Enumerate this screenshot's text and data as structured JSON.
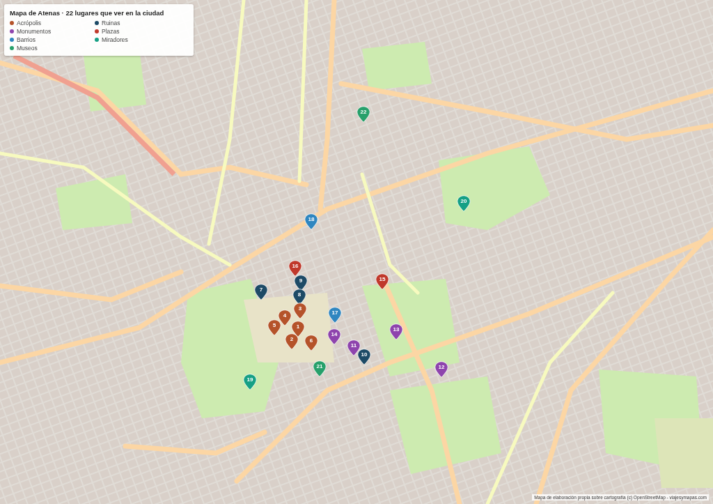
{
  "legend": {
    "title": "Mapa de Atenas · 22 lugares que ver en la ciudad",
    "items": [
      {
        "label": "Acrópolis",
        "color": "#b5532a"
      },
      {
        "label": "Monumentos",
        "color": "#8e44ad"
      },
      {
        "label": "Barrios",
        "color": "#2f86c0"
      },
      {
        "label": "Museos",
        "color": "#27a06b"
      },
      {
        "label": "Ruinas",
        "color": "#1d4a66"
      },
      {
        "label": "Plazas",
        "color": "#c0392b"
      },
      {
        "label": "Miradores",
        "color": "#16a085"
      }
    ]
  },
  "pins": [
    {
      "label": "1",
      "color": "#b5532a"
    },
    {
      "label": "2",
      "color": "#b5532a"
    },
    {
      "label": "3",
      "color": "#b5532a"
    },
    {
      "label": "4",
      "color": "#b5532a"
    },
    {
      "label": "5",
      "color": "#b5532a"
    },
    {
      "label": "6",
      "color": "#b5532a"
    },
    {
      "label": "7",
      "color": "#1d4a66"
    },
    {
      "label": "8",
      "color": "#1d4a66"
    },
    {
      "label": "9",
      "color": "#1d4a66"
    },
    {
      "label": "10",
      "color": "#1d4a66"
    },
    {
      "label": "11",
      "color": "#8e44ad"
    },
    {
      "label": "12",
      "color": "#8e44ad"
    },
    {
      "label": "13",
      "color": "#8e44ad"
    },
    {
      "label": "14",
      "color": "#8e44ad"
    },
    {
      "label": "15",
      "color": "#c0392b"
    },
    {
      "label": "16",
      "color": "#c0392b"
    },
    {
      "label": "17",
      "color": "#2f86c0"
    },
    {
      "label": "18",
      "color": "#2f86c0"
    },
    {
      "label": "19",
      "color": "#16a085"
    },
    {
      "label": "20",
      "color": "#16a085"
    },
    {
      "label": "21",
      "color": "#27a06b"
    },
    {
      "label": "22",
      "color": "#27a06b"
    }
  ],
  "attribution": "Mapa de elaboración propia sobre cartografía (c) OpenStreetMap - viajesymapas.com"
}
